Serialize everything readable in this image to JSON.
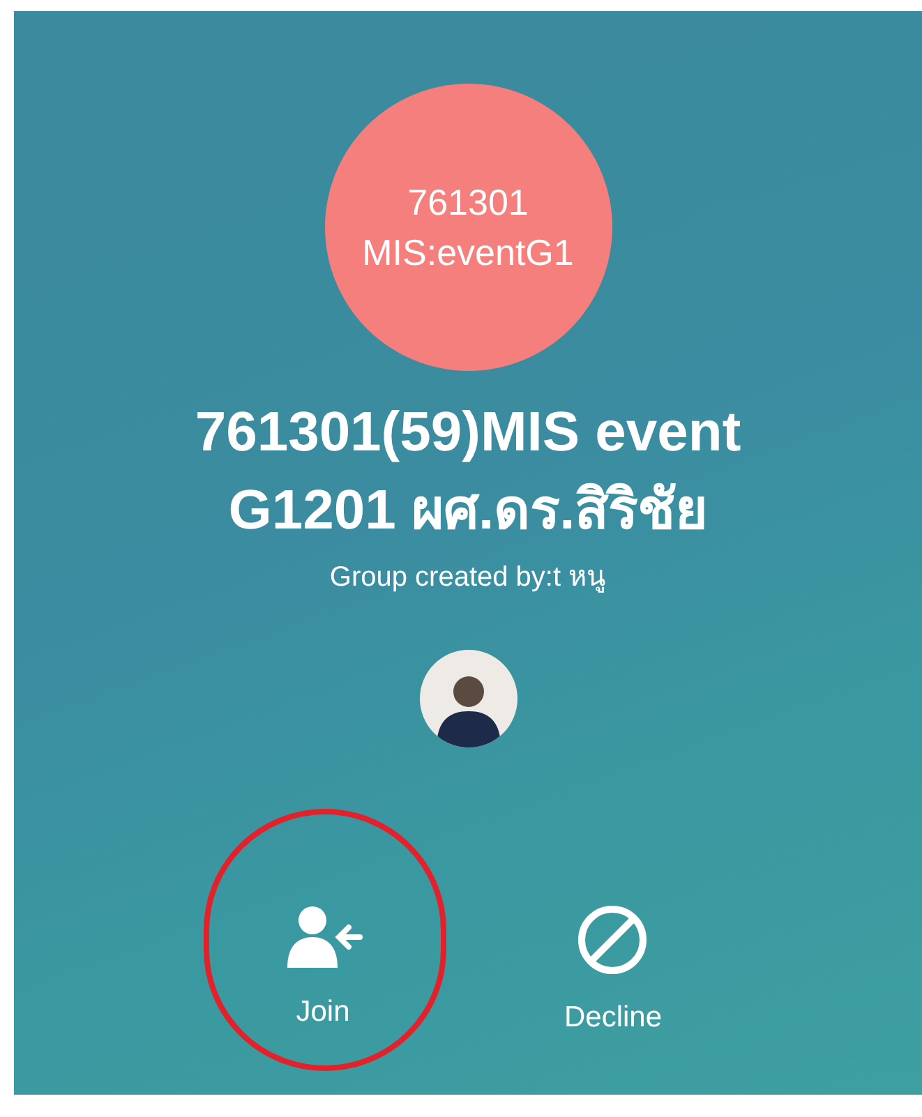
{
  "group_icon": {
    "lines": [
      "761301",
      "MIS:eventG1"
    ]
  },
  "group_name": [
    "761301(59)MIS event",
    "G1201  ผศ.ดร.สิริชัย"
  ],
  "creator": "Group created by:t หนู",
  "actions": [
    {
      "kind": "join",
      "label": "Join",
      "highlighted": true
    },
    {
      "kind": "decline",
      "label": "Decline",
      "highlighted": false
    }
  ]
}
